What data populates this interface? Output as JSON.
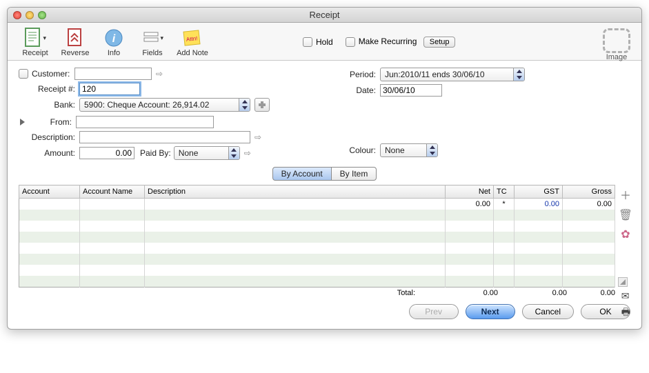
{
  "window": {
    "title": "Receipt"
  },
  "toolbar": {
    "receipt": "Receipt",
    "reverse": "Reverse",
    "info": "Info",
    "fields": "Fields",
    "addnote": "Add Note",
    "hold": "Hold",
    "make_recurring": "Make Recurring",
    "setup": "Setup",
    "image": "Image"
  },
  "form": {
    "customer_lbl": "Customer:",
    "customer_val": "",
    "receipt_lbl": "Receipt #:",
    "receipt_val": "120",
    "bank_lbl": "Bank:",
    "bank_val": "5900: Cheque Account: 26,914.02",
    "from_lbl": "From:",
    "from_val": "",
    "description_lbl": "Description:",
    "description_val": "",
    "amount_lbl": "Amount:",
    "amount_val": "0.00",
    "paidby_lbl": "Paid By:",
    "paidby_val": "None",
    "period_lbl": "Period:",
    "period_val": "Jun:2010/11 ends 30/06/10",
    "date_lbl": "Date:",
    "date_val": "30/06/10",
    "colour_lbl": "Colour:",
    "colour_val": "None"
  },
  "tabs": {
    "by_account": "By Account",
    "by_item": "By Item"
  },
  "grid": {
    "cols": {
      "account": "Account",
      "account_name": "Account Name",
      "description": "Description",
      "net": "Net",
      "tc": "TC",
      "gst": "GST",
      "gross": "Gross"
    },
    "rows": [
      {
        "account": "",
        "account_name": "",
        "description": "",
        "net": "0.00",
        "tc": "*",
        "gst": "0.00",
        "gross": "0.00"
      }
    ],
    "total_lbl": "Total:",
    "total_net": "0.00",
    "total_gst": "0.00",
    "total_gross": "0.00"
  },
  "footer": {
    "prev": "Prev",
    "next": "Next",
    "cancel": "Cancel",
    "ok": "OK"
  }
}
